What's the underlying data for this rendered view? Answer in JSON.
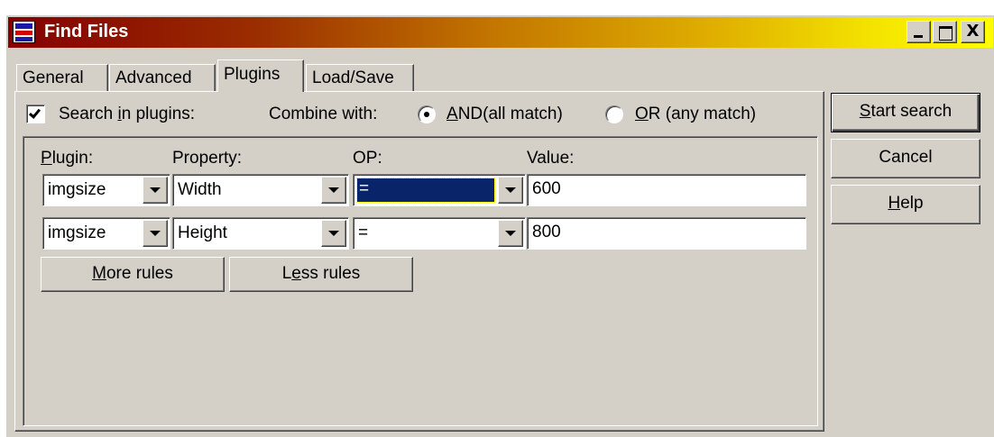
{
  "window": {
    "title": "Find Files",
    "controls": {
      "minimize": "_",
      "maximize": "□",
      "close": "X"
    }
  },
  "tabs": [
    {
      "label": "General",
      "active": false
    },
    {
      "label": "Advanced",
      "active": false
    },
    {
      "label": "Plugins",
      "active": true
    },
    {
      "label": "Load/Save",
      "active": false
    }
  ],
  "plugins_tab": {
    "search_in_plugins": {
      "label_pre": "Search ",
      "label_u": "i",
      "label_post": "n plugins:",
      "checked": true
    },
    "combine_with_label": "Combine with:",
    "and_option": {
      "label_u": "A",
      "label_post": "ND(all match)",
      "selected": true
    },
    "or_option": {
      "label_u": "O",
      "label_post": "R (any match)",
      "selected": false
    },
    "columns": {
      "plugin": {
        "u": "P",
        "rest": "lugin:"
      },
      "property": "Property:",
      "op": "OP:",
      "value": "Value:"
    },
    "rules": [
      {
        "plugin": "imgsize",
        "property": "Width",
        "op": "=",
        "value": "600",
        "op_focused": true
      },
      {
        "plugin": "imgsize",
        "property": "Height",
        "op": "=",
        "value": "800",
        "op_focused": false
      }
    ],
    "more_rules": {
      "u": "M",
      "rest": "ore rules"
    },
    "less_rules": {
      "pre": "L",
      "u": "e",
      "rest": "ss rules"
    }
  },
  "side_buttons": {
    "start_search": {
      "u": "S",
      "rest": "tart search"
    },
    "cancel": "Cancel",
    "help": {
      "u": "H",
      "rest": "elp"
    }
  },
  "colors": {
    "face": "#d4d0c8",
    "title_start": "#840000",
    "title_end": "#ffff00",
    "selection": "#0a246a"
  }
}
